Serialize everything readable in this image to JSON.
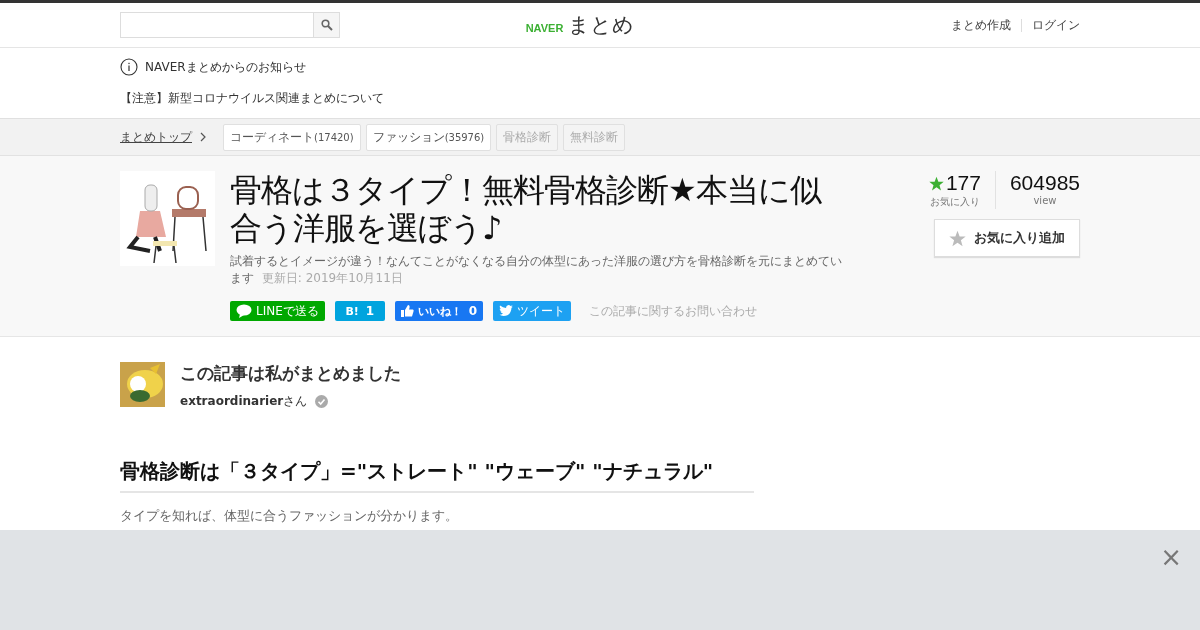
{
  "header": {
    "logo": {
      "brand": "NAVER",
      "name": "まとめ"
    },
    "links": [
      "まとめ作成",
      "ログイン"
    ]
  },
  "notice": {
    "title": "NAVERまとめからのお知らせ",
    "message": "【注意】新型コロナウイルス関連まとめについて"
  },
  "breadcrumb": {
    "home": "まとめトップ",
    "tags": [
      {
        "label": "コーディネート",
        "count": "(17420)",
        "disabled": false
      },
      {
        "label": "ファッション",
        "count": "(35976)",
        "disabled": false
      },
      {
        "label": "骨格診断",
        "disabled": true
      },
      {
        "label": "無料診断",
        "disabled": true
      }
    ]
  },
  "article": {
    "title": "骨格は３タイプ！無料骨格診断★本当に似合う洋服を選ぼう♪",
    "description": "試着するとイメージが違う！なんてことがなくなる自分の体型にあった洋服の選び方を骨格診断を元にまとめています",
    "updated": "更新日: 2019年10月11日",
    "share": [
      {
        "kind": "line",
        "label": "LINEで送る"
      },
      {
        "kind": "hatena",
        "label": "B!",
        "count": "1"
      },
      {
        "kind": "facebook",
        "label": "いいね！",
        "count": "0"
      },
      {
        "kind": "twitter",
        "label": "ツイート"
      }
    ],
    "contact": "この記事に関するお問い合わせ",
    "favorites": {
      "count": "177",
      "label": "お気に入り"
    },
    "views": {
      "count": "604985",
      "label": "view"
    },
    "favorite_button": "お気に入り追加"
  },
  "author": {
    "heading": "この記事は私がまとめました",
    "name": "extraordinarier",
    "suffix": "さん",
    "verified": true
  },
  "section": {
    "heading": "骨格診断は「３タイプ」=\"ストレート\" \"ウェーブ\" \"ナチュラル\"",
    "text": "タイプを知れば、体型に合うファッションが分かります。"
  },
  "ad": {
    "close": "×"
  }
}
